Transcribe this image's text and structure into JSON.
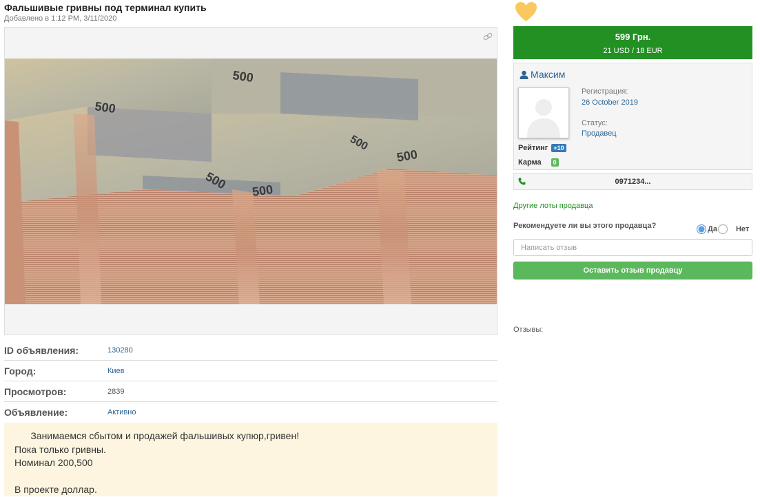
{
  "listing": {
    "title": "Фальшивые гривны под терминал купить",
    "added": "Добавлено в 1:12 PM, 3/11/2020",
    "image_alt": "500 гривень banknote stacks"
  },
  "info": [
    {
      "label": "ID объявления:",
      "value": "130280"
    },
    {
      "label": "Город:",
      "value": "Киев"
    },
    {
      "label": "Просмотров:",
      "value": "2839"
    },
    {
      "label": "Объявление:",
      "value": "Активно"
    }
  ],
  "description": [
    "      Занимаемся сбытом и продажей фальшивых купюр,гривен!",
    "Пока только гривны.",
    "Номинал 200,500",
    "",
    "В проекте доллар."
  ],
  "price": {
    "main": "599 Грн.",
    "sub": "21 USD / 18 EUR"
  },
  "seller": {
    "name": "Максим",
    "registration_label": "Регистрация:",
    "registration_date": "26 October 2019",
    "status_label": "Статус:",
    "status_value": "Продавец",
    "rating_label": "Рейтинг",
    "rating_value": "+10",
    "karma_label": "Карма",
    "karma_value": "0",
    "phone": "0971234...",
    "other_lots": "Другие лоты продавца"
  },
  "review": {
    "question": "Рекомендуете ли вы этого продавца?",
    "yes": "Да",
    "no": "Нет",
    "placeholder": "Написать отзыв",
    "submit": "Оставить отзыв продавцу",
    "reviews_label": "Отзывы:"
  },
  "colors": {
    "price_bg": "#239023",
    "heart": "#fbc85f",
    "description_bg": "#fdf5e0",
    "button_bg": "#5cb85c"
  }
}
